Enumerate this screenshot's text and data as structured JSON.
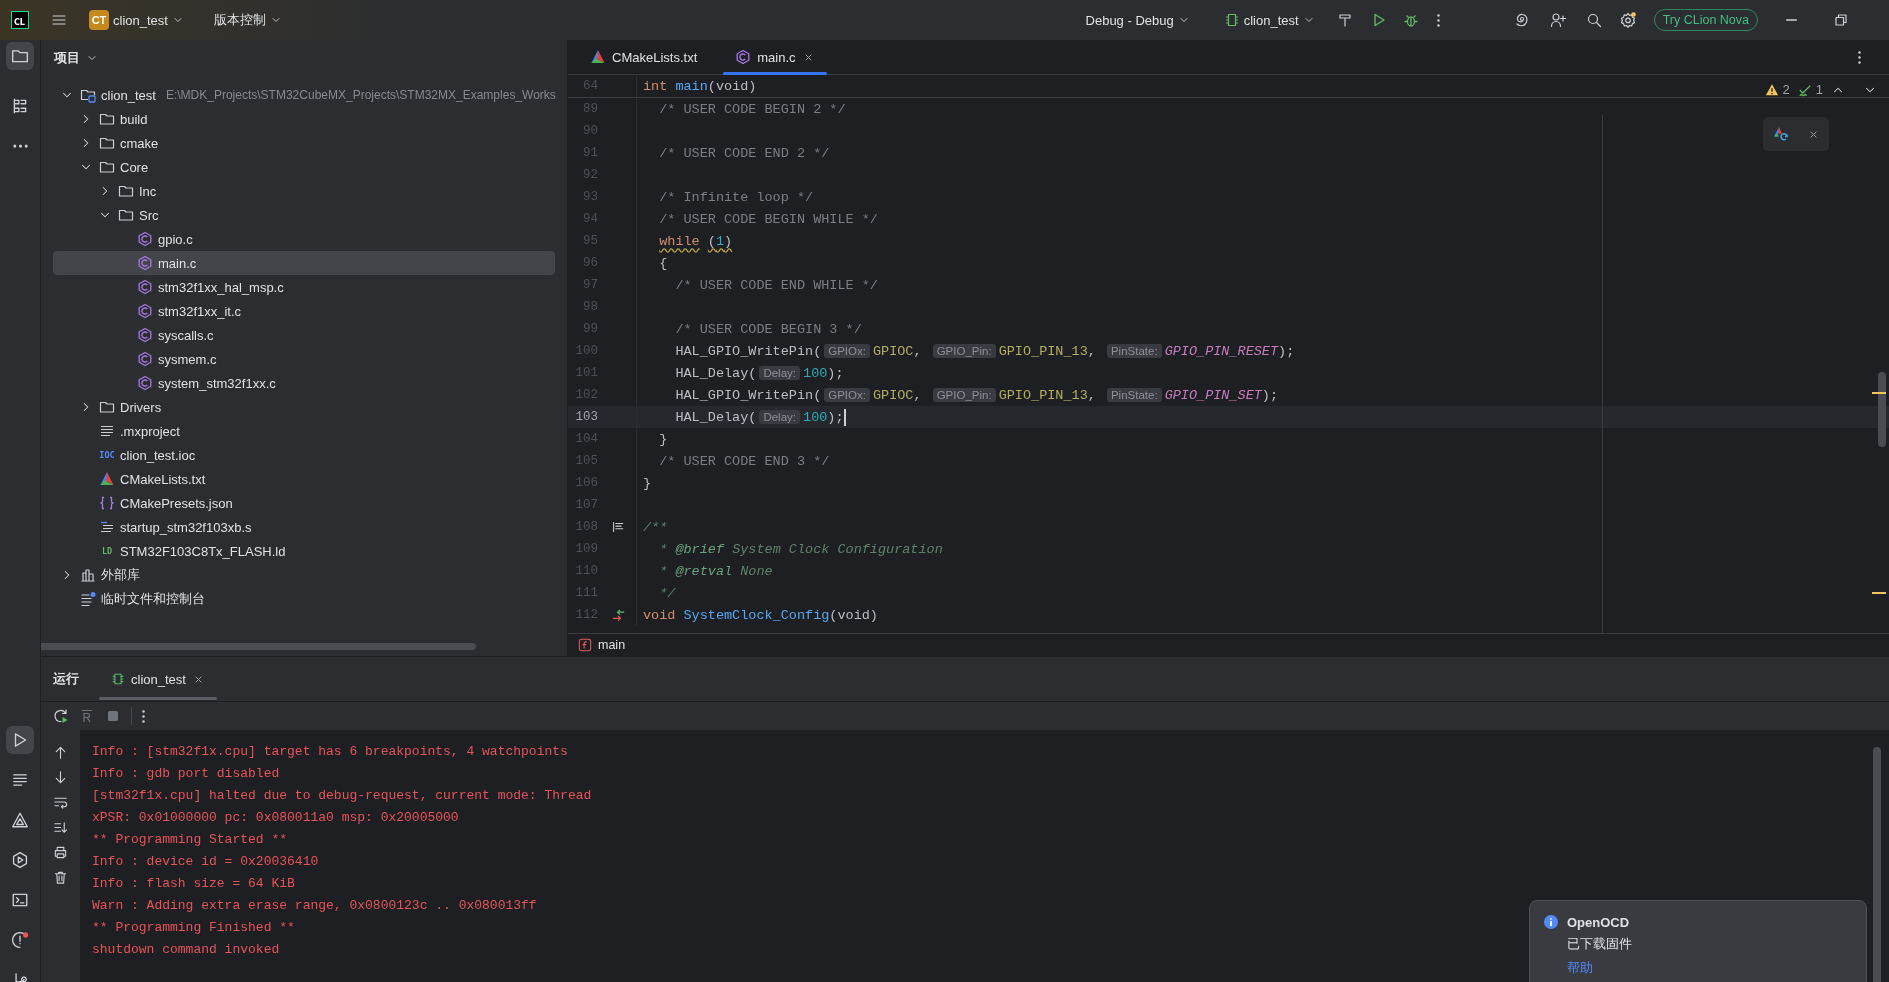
{
  "title_bar": {
    "logo": "CL",
    "project": {
      "badge": "CT",
      "name": "clion_test"
    },
    "vcs": "版本控制",
    "run_config_group": "Debug - Debug",
    "run_target": "clion_test",
    "promo_button": "Try CLion Nova"
  },
  "tool_stripe": {
    "top": [
      {
        "selected": true
      },
      {
        "selected": false
      },
      {
        "selected": false
      }
    ],
    "bottom": [
      {
        "selected": true
      },
      {
        "selected": false
      },
      {
        "selected": false
      },
      {
        "selected": false
      },
      {
        "selected": false
      },
      {
        "selected": false
      },
      {
        "selected": false
      }
    ]
  },
  "project_panel": {
    "title": "项目",
    "tree": [
      {
        "label": "clion_test",
        "path": "E:\\MDK_Projects\\STM32CubeMX_Projects\\STM32MX_Examples_Works",
        "kind": "project",
        "expanded": true,
        "selected": false,
        "children": [
          {
            "label": "build",
            "kind": "folder",
            "expanded": false,
            "selected": false
          },
          {
            "label": "cmake",
            "kind": "folder",
            "expanded": false,
            "selected": false
          },
          {
            "label": "Core",
            "kind": "folder",
            "expanded": true,
            "selected": false,
            "children": [
              {
                "label": "Inc",
                "kind": "folder",
                "expanded": false,
                "selected": false
              },
              {
                "label": "Src",
                "kind": "folder",
                "expanded": true,
                "selected": false,
                "children": [
                  {
                    "label": "gpio.c",
                    "kind": "c",
                    "selected": false
                  },
                  {
                    "label": "main.c",
                    "kind": "c",
                    "selected": true
                  },
                  {
                    "label": "stm32f1xx_hal_msp.c",
                    "kind": "c",
                    "selected": false
                  },
                  {
                    "label": "stm32f1xx_it.c",
                    "kind": "c",
                    "selected": false
                  },
                  {
                    "label": "syscalls.c",
                    "kind": "c",
                    "selected": false
                  },
                  {
                    "label": "sysmem.c",
                    "kind": "c",
                    "selected": false
                  },
                  {
                    "label": "system_stm32f1xx.c",
                    "kind": "c",
                    "selected": false
                  }
                ]
              }
            ]
          },
          {
            "label": "Drivers",
            "kind": "folder",
            "expanded": false,
            "selected": false
          },
          {
            "label": ".mxproject",
            "kind": "text",
            "selected": false
          },
          {
            "label": "clion_test.ioc",
            "kind": "ioc",
            "icon_text": "IOC",
            "selected": false
          },
          {
            "label": "CMakeLists.txt",
            "kind": "cmake",
            "selected": false
          },
          {
            "label": "CMakePresets.json",
            "kind": "json",
            "selected": false
          },
          {
            "label": "startup_stm32f103xb.s",
            "kind": "asm",
            "selected": false
          },
          {
            "label": "STM32F103C8Tx_FLASH.ld",
            "kind": "ld",
            "icon_text": "LD",
            "selected": false
          }
        ]
      },
      {
        "label": "外部库",
        "kind": "library",
        "expanded": false,
        "selected": false
      },
      {
        "label": "临时文件和控制台",
        "kind": "scratch",
        "selected": false
      }
    ]
  },
  "editor": {
    "tabs": [
      {
        "label": "CMakeLists.txt",
        "kind": "cmake",
        "selected": false,
        "closable": false
      },
      {
        "label": "main.c",
        "kind": "c",
        "selected": true,
        "closable": true
      }
    ],
    "inspections": {
      "warnings": "2",
      "weak_warnings": "1"
    },
    "sticky_line": {
      "number": "64",
      "tokens": [
        {
          "kind": "kw",
          "text": "int"
        },
        {
          "kind": "fn",
          "text": " main"
        },
        {
          "kind": "plain",
          "text": "(void)"
        }
      ]
    },
    "lines": [
      {
        "number": "89",
        "kind": "code",
        "current": false,
        "warn": false,
        "tokens": [
          {
            "kind": "comment",
            "text": "  /* USER CODE BEGIN 2 */"
          }
        ]
      },
      {
        "number": "90",
        "kind": "code",
        "current": false,
        "warn": false
      },
      {
        "number": "91",
        "kind": "code",
        "current": false,
        "warn": false,
        "tokens": [
          {
            "kind": "comment",
            "text": "  /* USER CODE END 2 */"
          }
        ]
      },
      {
        "number": "92",
        "kind": "code",
        "current": false,
        "warn": false
      },
      {
        "number": "93",
        "kind": "code",
        "current": false,
        "warn": false,
        "tokens": [
          {
            "kind": "comment",
            "text": "  /* Infinite loop */"
          }
        ]
      },
      {
        "number": "94",
        "kind": "code",
        "current": false,
        "warn": false,
        "tokens": [
          {
            "kind": "comment",
            "text": "  /* USER CODE BEGIN WHILE */"
          }
        ]
      },
      {
        "number": "95",
        "kind": "code",
        "current": false,
        "warn": true,
        "tokens": [
          {
            "kind": "kw",
            "text": "  while"
          },
          {
            "kind": "plain",
            "text": " ("
          },
          {
            "kind": "num",
            "text": "1"
          },
          {
            "kind": "plain",
            "text": ")"
          }
        ]
      },
      {
        "number": "96",
        "kind": "code",
        "current": false,
        "warn": false,
        "tokens": [
          {
            "kind": "plain",
            "text": "  {"
          }
        ]
      },
      {
        "number": "97",
        "kind": "code",
        "current": false,
        "warn": false,
        "tokens": [
          {
            "kind": "comment",
            "text": "    /* USER CODE END WHILE */"
          }
        ]
      },
      {
        "number": "98",
        "kind": "code",
        "current": false,
        "warn": false
      },
      {
        "number": "99",
        "kind": "code",
        "current": false,
        "warn": false,
        "tokens": [
          {
            "kind": "comment",
            "text": "    /* USER CODE BEGIN 3 */"
          }
        ]
      },
      {
        "number": "100",
        "kind": "code",
        "current": false,
        "warn": false,
        "tokens": [
          {
            "kind": "plain",
            "text": "    HAL_GPIO_WritePin("
          },
          {
            "kind": "hint",
            "text": "GPIOx:"
          },
          {
            "kind": "macro",
            "text": "GPIOC"
          },
          {
            "kind": "plain",
            "text": ", "
          },
          {
            "kind": "hint",
            "text": "GPIO_Pin:"
          },
          {
            "kind": "macro",
            "text": "GPIO_PIN_13"
          },
          {
            "kind": "plain",
            "text": ", "
          },
          {
            "kind": "hint",
            "text": "PinState:"
          },
          {
            "kind": "enum",
            "text": "GPIO_PIN_RESET"
          },
          {
            "kind": "plain",
            "text": ");"
          }
        ]
      },
      {
        "number": "101",
        "kind": "code",
        "current": false,
        "warn": false,
        "tokens": [
          {
            "kind": "plain",
            "text": "    HAL_Delay("
          },
          {
            "kind": "hint",
            "text": "Delay:"
          },
          {
            "kind": "num",
            "text": "100"
          },
          {
            "kind": "plain",
            "text": ");"
          }
        ]
      },
      {
        "number": "102",
        "kind": "code",
        "current": false,
        "warn": false,
        "tokens": [
          {
            "kind": "plain",
            "text": "    HAL_GPIO_WritePin("
          },
          {
            "kind": "hint",
            "text": "GPIOx:"
          },
          {
            "kind": "macro",
            "text": "GPIOC"
          },
          {
            "kind": "plain",
            "text": ", "
          },
          {
            "kind": "hint",
            "text": "GPIO_Pin:"
          },
          {
            "kind": "macro",
            "text": "GPIO_PIN_13"
          },
          {
            "kind": "plain",
            "text": ", "
          },
          {
            "kind": "hint",
            "text": "PinState:"
          },
          {
            "kind": "enum",
            "text": "GPIO_PIN_SET"
          },
          {
            "kind": "plain",
            "text": ");"
          }
        ]
      },
      {
        "number": "103",
        "kind": "code",
        "current": true,
        "warn": false,
        "tokens": [
          {
            "kind": "plain",
            "text": "    HAL_Delay("
          },
          {
            "kind": "hint",
            "text": "Delay:"
          },
          {
            "kind": "num",
            "text": "100"
          },
          {
            "kind": "plain",
            "text": ");"
          }
        ]
      },
      {
        "number": "104",
        "kind": "code",
        "current": false,
        "warn": false,
        "tokens": [
          {
            "kind": "plain",
            "text": "  }"
          }
        ]
      },
      {
        "number": "105",
        "kind": "code",
        "current": false,
        "warn": false,
        "tokens": [
          {
            "kind": "comment",
            "text": "  /* USER CODE END 3 */"
          }
        ]
      },
      {
        "number": "106",
        "kind": "code",
        "current": false,
        "warn": false,
        "tokens": [
          {
            "kind": "plain",
            "text": "}"
          }
        ]
      },
      {
        "number": "107",
        "kind": "code",
        "current": false,
        "warn": false
      },
      {
        "number": "108",
        "kind": "doc-start",
        "current": false,
        "warn": false,
        "tokens": [
          {
            "kind": "doc",
            "text": "/**"
          }
        ]
      },
      {
        "number": "109",
        "kind": "code",
        "current": false,
        "warn": false,
        "tokens": [
          {
            "kind": "doc",
            "text": "  *"
          },
          {
            "kind": "doctag",
            "text": " @brief"
          },
          {
            "kind": "doc",
            "text": " System Clock Configuration"
          }
        ]
      },
      {
        "number": "110",
        "kind": "code",
        "current": false,
        "warn": false,
        "tokens": [
          {
            "kind": "doc",
            "text": "  *"
          },
          {
            "kind": "doctag",
            "text": " @retval"
          },
          {
            "kind": "doc",
            "text": " None"
          }
        ]
      },
      {
        "number": "111",
        "kind": "code",
        "current": false,
        "warn": false,
        "tokens": [
          {
            "kind": "doc",
            "text": "  */"
          }
        ]
      },
      {
        "number": "112",
        "kind": "declaration",
        "current": false,
        "warn": false,
        "tokens": [
          {
            "kind": "kw",
            "text": "void"
          },
          {
            "kind": "fn",
            "text": " SystemClock_Config"
          },
          {
            "kind": "plain",
            "text": "(void)"
          }
        ]
      }
    ],
    "breadcrumb": "main"
  },
  "run_panel": {
    "title": "运行",
    "tabs": [
      {
        "label": "clion_test",
        "selected": true
      }
    ],
    "console": [
      "Info : [stm32f1x.cpu] target has 6 breakpoints, 4 watchpoints",
      "Info : gdb port disabled",
      "[stm32f1x.cpu] halted due to debug-request, current mode: Thread",
      "xPSR: 0x01000000 pc: 0x080011a0 msp: 0x20005000",
      "** Programming Started **",
      "Info : device id = 0x20036410",
      "Info : flash size = 64 KiB",
      "Warn : Adding extra erase range, 0x0800123c .. 0x080013ff",
      "** Programming Finished **",
      "shutdown command invoked"
    ]
  },
  "notification": {
    "title": "OpenOCD",
    "message": "已下载固件",
    "link": "帮助"
  }
}
